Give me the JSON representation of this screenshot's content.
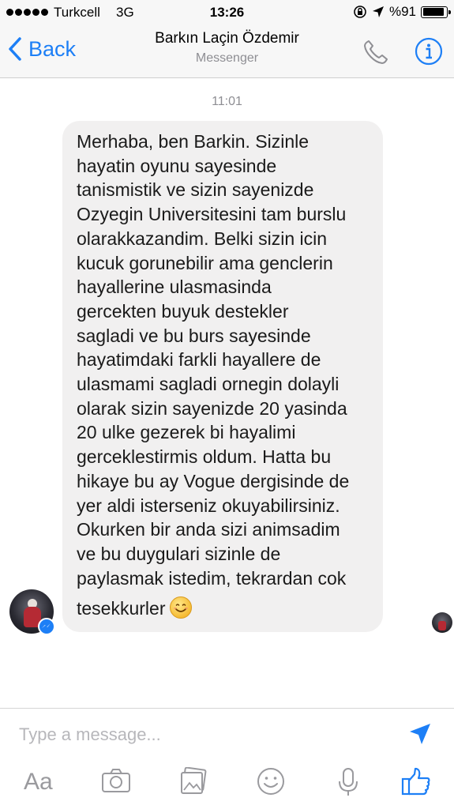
{
  "status_bar": {
    "carrier": "Turkcell",
    "network": "3G",
    "time": "13:26",
    "battery_text": "%91",
    "battery_level": 0.91
  },
  "nav": {
    "back_label": "Back",
    "title": "Barkın Laçin Özdemir",
    "subtitle": "Messenger"
  },
  "chat": {
    "timestamp": "11:01",
    "message_lines": [
      "Merhaba, ben Barkin. Sizinle",
      "hayatin oyunu sayesinde",
      "tanismistik ve sizin sayenizde",
      "Ozyegin Universitesini tam burslu",
      "olarakkazandim. Belki sizin icin",
      "kucuk gorunebilir ama genclerin",
      "hayallerine ulasmasinda",
      "gercekten buyuk destekler",
      "sagladi ve bu burs sayesinde",
      "hayatimdaki farkli hayallere de",
      "ulasmami sagladi ornegin dolayli",
      "olarak sizin sayenizde 20 yasinda",
      "20 ulke gezerek bi hayalimi",
      "gerceklestirmis oldum. Hatta bu",
      "hikaye bu ay Vogue dergisinde de",
      "yer aldi isterseniz okuyabilirsiniz.",
      "Okurken bir anda sizi animsadim",
      "ve bu duygulari sizinle de",
      "paylasmak istedim, tekrardan cok",
      "tesekkurler"
    ],
    "emoji": "smiling-face"
  },
  "composer": {
    "placeholder": "Type a message...",
    "text_format_label": "Aa"
  },
  "colors": {
    "accent": "#1d7ff6",
    "bubble": "#f1f0f0",
    "toolbar_icon": "#9a9a9e"
  }
}
